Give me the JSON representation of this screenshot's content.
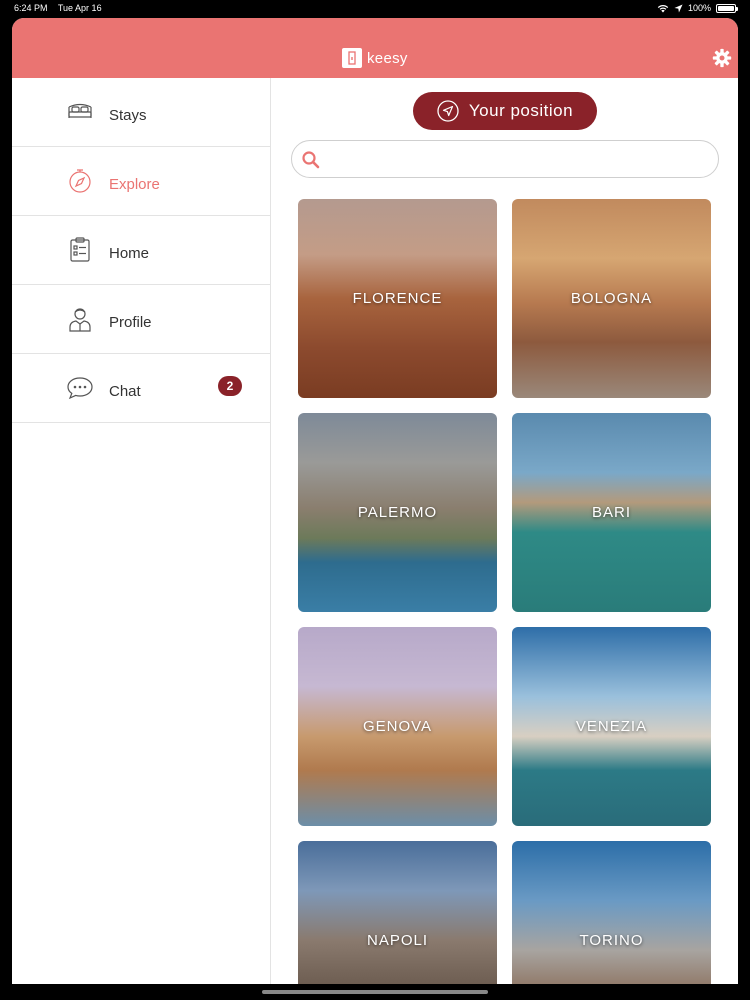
{
  "status_bar": {
    "time": "6:24 PM",
    "date": "Tue Apr 16",
    "battery": "100%"
  },
  "header": {
    "logo_text": "keesy",
    "accent_color": "#ea7472"
  },
  "sidebar": {
    "items": [
      {
        "label": "Stays",
        "icon": "bed-icon"
      },
      {
        "label": "Explore",
        "icon": "compass-icon"
      },
      {
        "label": "Home",
        "icon": "clipboard-icon"
      },
      {
        "label": "Profile",
        "icon": "person-icon"
      },
      {
        "label": "Chat",
        "icon": "chat-bubble-icon",
        "badge": "2"
      }
    ],
    "active": "Explore"
  },
  "main": {
    "position_button": "Your position",
    "search": {
      "value": "",
      "placeholder": ""
    },
    "cities": [
      "FLORENCE",
      "BOLOGNA",
      "PALERMO",
      "BARI",
      "GENOVA",
      "VENEZIA",
      "NAPOLI",
      "TORINO"
    ]
  },
  "colors": {
    "accent": "#ea7472",
    "dark_accent": "#8a2229"
  }
}
